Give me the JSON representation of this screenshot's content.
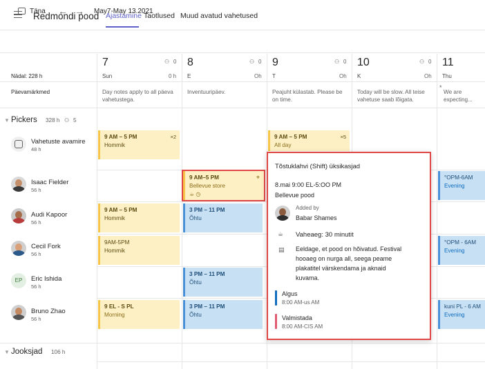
{
  "header": {
    "app_title": "Redmondi pood",
    "tabs": [
      "Ajastamine",
      "Taotlused",
      "Muud avatud vahetused"
    ]
  },
  "toolbar": {
    "today": "Täna",
    "date_range": "May7-May 13.2021"
  },
  "week": {
    "hours_label": "Nädal: 228 h",
    "notes_label": "Päevamärkmed"
  },
  "days": [
    {
      "num": "7",
      "name": "Sun",
      "hours": "0 h",
      "people": "0",
      "note": "Day notes apply to all päeva vahetustega."
    },
    {
      "num": "8",
      "name": "E",
      "hours": "Oh",
      "people": "0",
      "note": "Inventuuripäev."
    },
    {
      "num": "9",
      "name": "T",
      "hours": "Oh",
      "people": "0",
      "note": "Peajuht külastab. Please be on time."
    },
    {
      "num": "10",
      "name": "K",
      "hours": "Oh",
      "people": "0",
      "note": "Today will be slow. All teise vahetuse saab lõigata."
    },
    {
      "num": "11",
      "name": "Thu",
      "hours": "",
      "people": "",
      "note": "We are expecting... es.päris hõivatud."
    }
  ],
  "groups": {
    "pickers": {
      "title": "Pickers",
      "hours": "328 h",
      "people": "5"
    },
    "runners": {
      "title": "Jooksjad",
      "hours": "106 h"
    }
  },
  "people": [
    {
      "name": "Vahetuste avamire",
      "hours": "48 h"
    },
    {
      "name": "Isaac Fielder",
      "hours": "56 h"
    },
    {
      "name": "Audi Kapoor",
      "hours": "56 h"
    },
    {
      "name": "Cecil Fork",
      "hours": "56 h"
    },
    {
      "name": "Eric Ishida",
      "hours": "56 h",
      "initials": "EP"
    },
    {
      "name": "Bruno Zhao",
      "hours": "56 h"
    }
  ],
  "shifts": {
    "open_sun": {
      "time": "9 AM – 5 PM",
      "label": "Hommik",
      "count": "×2"
    },
    "open_tue": {
      "time": "9 AM – 5 PM",
      "label": "All day",
      "count": "×5"
    },
    "isaac_mon": {
      "time": "9 AM–5 PM",
      "label": "Bellevue store"
    },
    "isaac_thu": {
      "time": "°OPM-6AM",
      "label": "Evening"
    },
    "audi_sun": {
      "time": "9 AM – 5 PM",
      "label": "Hommik"
    },
    "audi_mon": {
      "time": "3 PM – 11 PM",
      "label": "Õhtu"
    },
    "cecil_sun": {
      "time": "9AM-5PM",
      "label": "Hommik"
    },
    "cecil_thu": {
      "time": "°OPM - 6AM",
      "label": "Evening"
    },
    "eric_mon": {
      "time": "3 PM – 11 PM",
      "label": "Õhtu"
    },
    "bruno_sun": {
      "time": "9 EL - S PL",
      "label": "Morning"
    },
    "bruno_mon": {
      "time": "3 PM – 11 PM",
      "label": "Õhtu"
    },
    "bruno_thu": {
      "time": "kuni PL - 6 AM",
      "label": "Evening"
    }
  },
  "popup": {
    "title": "Tõstuklahvi (Shift) üksikasjad",
    "datetime": "8.mai 9:00 EL-5:OO PM",
    "location": "Bellevue pood",
    "added_by_label": "Added by",
    "added_by_name": "Babar Shames",
    "break": "Vaheaeg: 30 minutit",
    "note_lines": [
      "Eeldage, et pood on hõivatud. Festival",
      "hooaeg on nurga all, seega peame",
      "plakatitel värskendama ja aknaid",
      "kuvama."
    ],
    "start_label": "Algus",
    "start_time": "8:00 AM-us AM",
    "end_label": "Valmistada",
    "end_time": "8:00 AM-CIS AM"
  },
  "colors": {
    "accent": "#5b5fc7",
    "highlight": "#e04646",
    "start_bar": "#0f6cbd",
    "end_bar": "#e05a72"
  }
}
